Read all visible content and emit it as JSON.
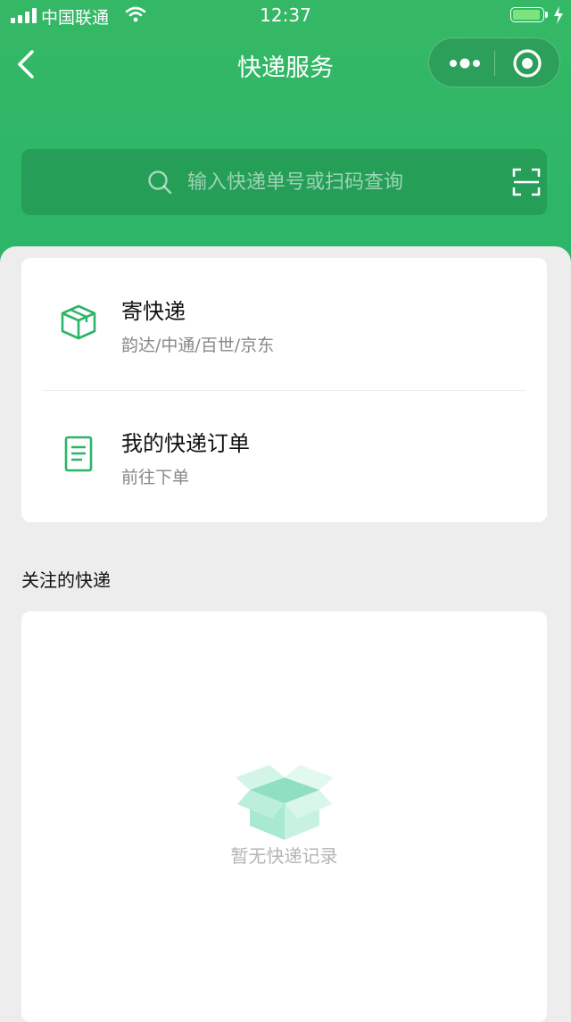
{
  "status_bar": {
    "carrier": "中国联通",
    "time": "12:37"
  },
  "nav": {
    "title": "快递服务"
  },
  "search": {
    "placeholder": "输入快递单号或扫码查询"
  },
  "menu": [
    {
      "title": "寄快递",
      "subtitle": "韵达/中通/百世/京东",
      "icon": "package-box-icon"
    },
    {
      "title": "我的快递订单",
      "subtitle": "前往下单",
      "icon": "order-document-icon"
    }
  ],
  "followed": {
    "section_title": "关注的快递",
    "empty_text": "暂无快递记录"
  },
  "colors": {
    "brand_green": "#2bb568",
    "search_bg": "#259e58"
  }
}
